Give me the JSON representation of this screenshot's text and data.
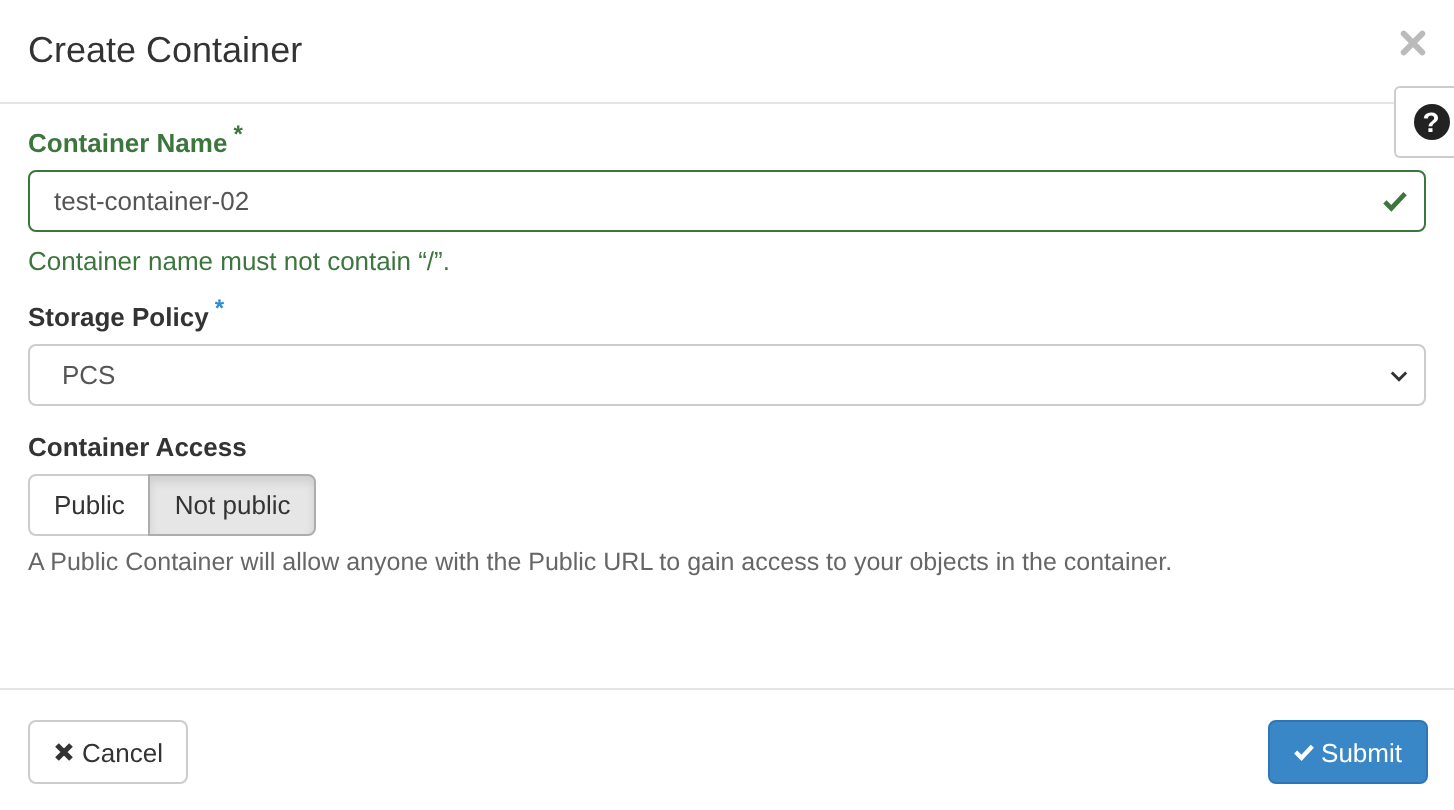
{
  "dialog": {
    "title": "Create Container",
    "help_tab": "?"
  },
  "container_name": {
    "label": "Container Name",
    "required_mark": "*",
    "value": "test-container-02",
    "valid": true,
    "help_text": "Container name must not contain “/”."
  },
  "storage_policy": {
    "label": "Storage Policy",
    "required_mark": "*",
    "value": "PCS"
  },
  "container_access": {
    "label": "Container Access",
    "options": [
      {
        "label": "Public",
        "selected": false
      },
      {
        "label": "Not public",
        "selected": true
      }
    ],
    "description": "A Public Container will allow anyone with the Public URL to gain access to your objects in the container."
  },
  "buttons": [
    {
      "kind": "cancel",
      "label": "Cancel"
    },
    {
      "kind": "submit",
      "label": "Submit"
    }
  ]
}
